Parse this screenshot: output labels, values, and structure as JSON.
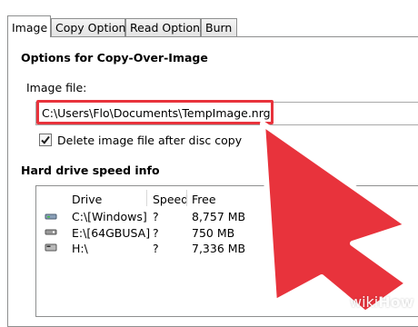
{
  "tabs": [
    {
      "label": "Image",
      "active": true
    },
    {
      "label": "Copy Options",
      "active": false
    },
    {
      "label": "Read Options",
      "active": false
    },
    {
      "label": "Burn",
      "active": false
    }
  ],
  "copy_over_image": {
    "title": "Options for Copy-Over-Image",
    "image_file_label": "Image file:",
    "image_file_value": "C:\\Users\\Flo\\Documents\\TempImage.nrg",
    "delete_checkbox_label": "Delete image file after disc copy",
    "delete_checked": true
  },
  "hard_drive": {
    "title": "Hard drive speed info",
    "columns": [
      "Drive",
      "Speed",
      "Free"
    ],
    "rows": [
      {
        "icon": "hard-drive-icon",
        "drive": "C:\\[Windows]",
        "speed": "?",
        "free": "8,757 MB"
      },
      {
        "icon": "usb-drive-icon",
        "drive": "E:\\[64GBUSA]",
        "speed": "?",
        "free": "750 MB"
      },
      {
        "icon": "sd-card-icon",
        "drive": "H:\\",
        "speed": "?",
        "free": "7,336 MB"
      }
    ]
  },
  "overlay": {
    "highlight_color": "#e8333c",
    "cursor_color": "#e8333c",
    "watermark": {
      "prefix": "wiki",
      "suffix": "How"
    }
  }
}
